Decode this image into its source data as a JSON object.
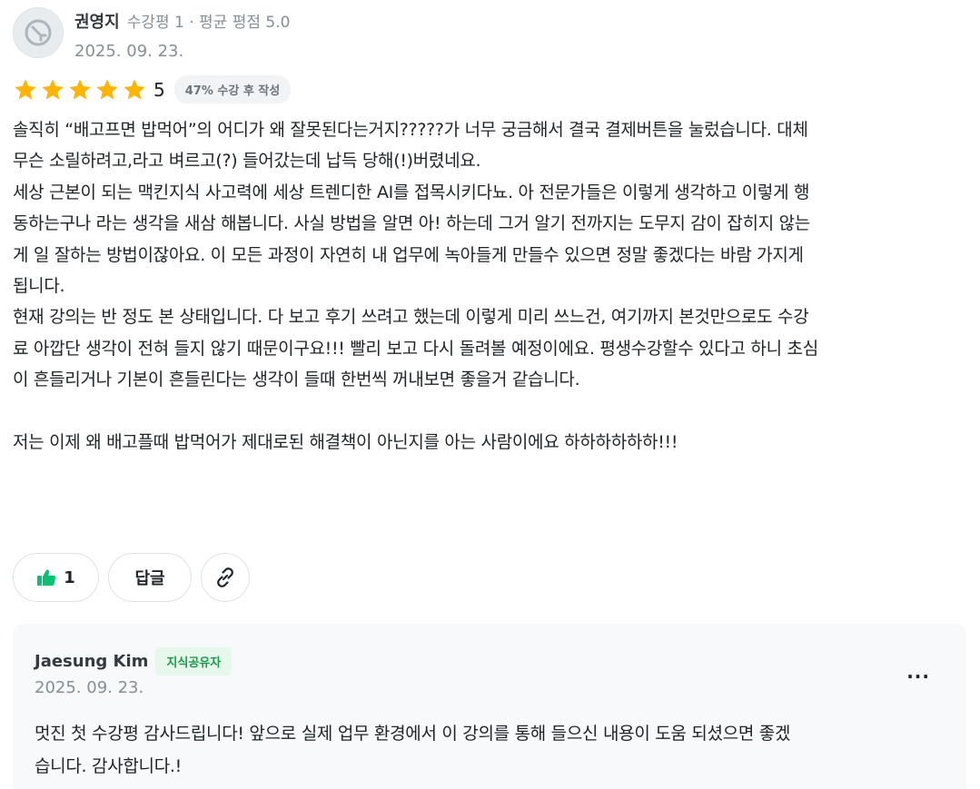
{
  "review": {
    "author_name": "권영지",
    "author_meta": "수강평 1 · 평균 평점 5.0",
    "date": "2025. 09. 23.",
    "rating": 5,
    "rating_label": "5",
    "progress_badge": "47% 수강 후 작성",
    "star_color": "#ffb400",
    "body_lines": [
      "솔직히 “배고프면 밥먹어”의 어디가 왜 잘못된다는거지?????가 너무 궁금해서 결국 결제버튼을 눌렀습니다. 대체",
      "무슨 소릴하려고,라고 벼르고(?) 들어갔는데 납득 당해(!)버렸네요.",
      "세상 근본이 되는 맥킨지식 사고력에 세상 트렌디한 AI를 접목시키다뇨. 아 전문가들은 이렇게 생각하고 이렇게 행",
      "동하는구나 라는 생각을 새삼 해봅니다. 사실 방법을 알면 아! 하는데 그거 알기 전까지는 도무지 감이 잡히지 않는",
      "게 일 잘하는 방법이잖아요. 이 모든 과정이 자연히 내 업무에 녹아들게 만들수 있으면 정말 좋겠다는 바람 가지게",
      "됩니다.",
      "현재 강의는 반 정도 본 상태입니다. 다 보고 후기 쓰려고 했는데 이렇게 미리 쓰느건, 여기까지 본것만으로도 수강",
      "료 아깝단 생각이 전혀 들지 않기 때문이구요!!! 빨리 보고 다시 돌려볼 예정이에요. 평생수강할수 있다고 하니 초심",
      "이 흔들리거나 기본이 흔들린다는 생각이 들때 한번씩 꺼내보면 좋을거 같습니다.",
      "",
      "저는 이제 왜 배고플때 밥먹어가 제대로된 해결책이 아닌지를 아는 사람이에요 하하하하하하!!!"
    ]
  },
  "actions": {
    "like_count": "1",
    "reply_label": "답글",
    "like_icon": "thumbs-up-icon",
    "like_color": "#00c471",
    "link_icon": "link-icon"
  },
  "reply": {
    "author_name": "Jaesung Kim",
    "badge": "지식공유자",
    "date": "2025. 09. 23.",
    "more_label": "···",
    "body_lines": [
      "멋진 첫 수강평 감사드립니다! 앞으로 실제 업무 환경에서 이 강의를 통해 들으신 내용이 도움 되셨으면 좋겠",
      "습니다. 감사합니다.!"
    ]
  }
}
